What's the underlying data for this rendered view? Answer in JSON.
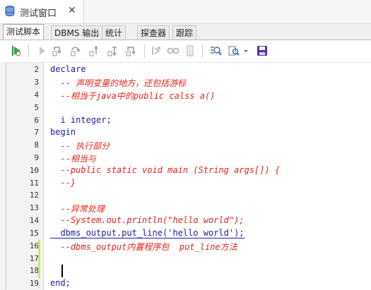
{
  "window_tab": {
    "title": "测试窗口",
    "close_glyph": "✕",
    "icon": "database-icon"
  },
  "inner_tabs": [
    {
      "label": "测试脚本",
      "active": true
    },
    {
      "label": "DBMS 输出",
      "active": false
    },
    {
      "label": "统计",
      "active": false
    },
    {
      "label": "探查器",
      "active": false
    },
    {
      "label": "跟踪",
      "active": false
    }
  ],
  "toolbar": {
    "icons": [
      "run-icon",
      "step-icon",
      "step-into-icon",
      "step-over-icon",
      "step-out-icon",
      "run-to-exception-icon",
      "step-back-icon",
      "breakpoint-icon",
      "watch-icon",
      "trace-icon",
      "find-icon",
      "zoom-icon",
      "dropdown-icon",
      "save-icon"
    ]
  },
  "colors": {
    "comment": "#e8231a",
    "keyword": "#1c1ca8",
    "gutter_mark": "#c9e86a"
  },
  "editor": {
    "lines": [
      {
        "num": "2",
        "text": "declare"
      },
      {
        "num": "3",
        "text": "  -- 声明变量的地方，还包括游标"
      },
      {
        "num": "4",
        "text": "  --相当于java中的public calss a()"
      },
      {
        "num": "5",
        "text": ""
      },
      {
        "num": "6",
        "text": "  i integer;"
      },
      {
        "num": "7",
        "text": "begin"
      },
      {
        "num": "8",
        "text": "  -- 执行部分"
      },
      {
        "num": "9",
        "text": "  --相当与"
      },
      {
        "num": "10",
        "text": "  --public static void main (String args[]) {"
      },
      {
        "num": "11",
        "text": "  --}"
      },
      {
        "num": "12",
        "text": ""
      },
      {
        "num": "13",
        "text": "  --异常处理"
      },
      {
        "num": "14",
        "text": "  --System.out.println(\"hello world\");"
      },
      {
        "num": "15",
        "text": "  dbms_output.put_line('hello world');"
      },
      {
        "num": "16",
        "text": "  --dbms_output内置程序包  put_line方法"
      },
      {
        "num": "17",
        "text": ""
      },
      {
        "num": "18",
        "text": ""
      },
      {
        "num": "19",
        "text": "end;"
      }
    ]
  }
}
